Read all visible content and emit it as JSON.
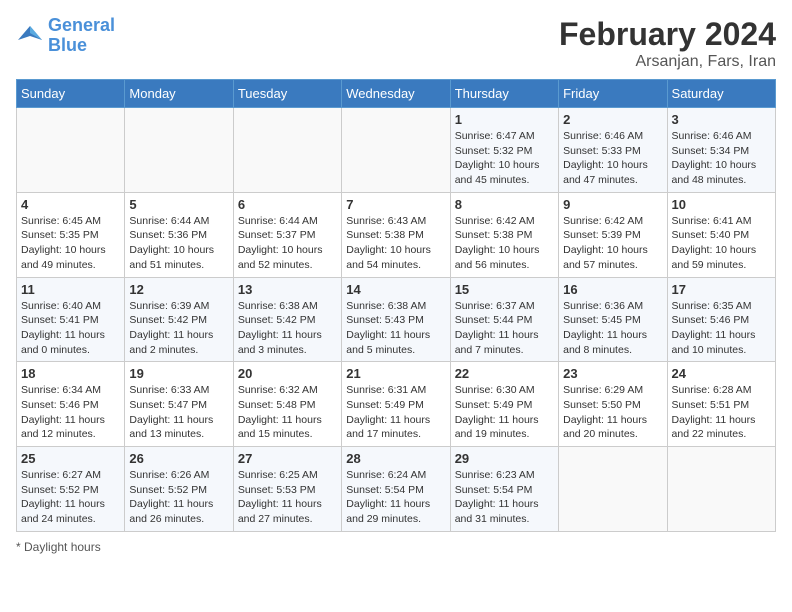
{
  "header": {
    "logo_line1": "General",
    "logo_line2": "Blue",
    "month": "February 2024",
    "location": "Arsanjan, Fars, Iran"
  },
  "weekdays": [
    "Sunday",
    "Monday",
    "Tuesday",
    "Wednesday",
    "Thursday",
    "Friday",
    "Saturday"
  ],
  "weeks": [
    [
      {
        "day": "",
        "sunrise": "",
        "sunset": "",
        "daylight": ""
      },
      {
        "day": "",
        "sunrise": "",
        "sunset": "",
        "daylight": ""
      },
      {
        "day": "",
        "sunrise": "",
        "sunset": "",
        "daylight": ""
      },
      {
        "day": "",
        "sunrise": "",
        "sunset": "",
        "daylight": ""
      },
      {
        "day": "1",
        "sunrise": "Sunrise: 6:47 AM",
        "sunset": "Sunset: 5:32 PM",
        "daylight": "Daylight: 10 hours and 45 minutes."
      },
      {
        "day": "2",
        "sunrise": "Sunrise: 6:46 AM",
        "sunset": "Sunset: 5:33 PM",
        "daylight": "Daylight: 10 hours and 47 minutes."
      },
      {
        "day": "3",
        "sunrise": "Sunrise: 6:46 AM",
        "sunset": "Sunset: 5:34 PM",
        "daylight": "Daylight: 10 hours and 48 minutes."
      }
    ],
    [
      {
        "day": "4",
        "sunrise": "Sunrise: 6:45 AM",
        "sunset": "Sunset: 5:35 PM",
        "daylight": "Daylight: 10 hours and 49 minutes."
      },
      {
        "day": "5",
        "sunrise": "Sunrise: 6:44 AM",
        "sunset": "Sunset: 5:36 PM",
        "daylight": "Daylight: 10 hours and 51 minutes."
      },
      {
        "day": "6",
        "sunrise": "Sunrise: 6:44 AM",
        "sunset": "Sunset: 5:37 PM",
        "daylight": "Daylight: 10 hours and 52 minutes."
      },
      {
        "day": "7",
        "sunrise": "Sunrise: 6:43 AM",
        "sunset": "Sunset: 5:38 PM",
        "daylight": "Daylight: 10 hours and 54 minutes."
      },
      {
        "day": "8",
        "sunrise": "Sunrise: 6:42 AM",
        "sunset": "Sunset: 5:38 PM",
        "daylight": "Daylight: 10 hours and 56 minutes."
      },
      {
        "day": "9",
        "sunrise": "Sunrise: 6:42 AM",
        "sunset": "Sunset: 5:39 PM",
        "daylight": "Daylight: 10 hours and 57 minutes."
      },
      {
        "day": "10",
        "sunrise": "Sunrise: 6:41 AM",
        "sunset": "Sunset: 5:40 PM",
        "daylight": "Daylight: 10 hours and 59 minutes."
      }
    ],
    [
      {
        "day": "11",
        "sunrise": "Sunrise: 6:40 AM",
        "sunset": "Sunset: 5:41 PM",
        "daylight": "Daylight: 11 hours and 0 minutes."
      },
      {
        "day": "12",
        "sunrise": "Sunrise: 6:39 AM",
        "sunset": "Sunset: 5:42 PM",
        "daylight": "Daylight: 11 hours and 2 minutes."
      },
      {
        "day": "13",
        "sunrise": "Sunrise: 6:38 AM",
        "sunset": "Sunset: 5:42 PM",
        "daylight": "Daylight: 11 hours and 3 minutes."
      },
      {
        "day": "14",
        "sunrise": "Sunrise: 6:38 AM",
        "sunset": "Sunset: 5:43 PM",
        "daylight": "Daylight: 11 hours and 5 minutes."
      },
      {
        "day": "15",
        "sunrise": "Sunrise: 6:37 AM",
        "sunset": "Sunset: 5:44 PM",
        "daylight": "Daylight: 11 hours and 7 minutes."
      },
      {
        "day": "16",
        "sunrise": "Sunrise: 6:36 AM",
        "sunset": "Sunset: 5:45 PM",
        "daylight": "Daylight: 11 hours and 8 minutes."
      },
      {
        "day": "17",
        "sunrise": "Sunrise: 6:35 AM",
        "sunset": "Sunset: 5:46 PM",
        "daylight": "Daylight: 11 hours and 10 minutes."
      }
    ],
    [
      {
        "day": "18",
        "sunrise": "Sunrise: 6:34 AM",
        "sunset": "Sunset: 5:46 PM",
        "daylight": "Daylight: 11 hours and 12 minutes."
      },
      {
        "day": "19",
        "sunrise": "Sunrise: 6:33 AM",
        "sunset": "Sunset: 5:47 PM",
        "daylight": "Daylight: 11 hours and 13 minutes."
      },
      {
        "day": "20",
        "sunrise": "Sunrise: 6:32 AM",
        "sunset": "Sunset: 5:48 PM",
        "daylight": "Daylight: 11 hours and 15 minutes."
      },
      {
        "day": "21",
        "sunrise": "Sunrise: 6:31 AM",
        "sunset": "Sunset: 5:49 PM",
        "daylight": "Daylight: 11 hours and 17 minutes."
      },
      {
        "day": "22",
        "sunrise": "Sunrise: 6:30 AM",
        "sunset": "Sunset: 5:49 PM",
        "daylight": "Daylight: 11 hours and 19 minutes."
      },
      {
        "day": "23",
        "sunrise": "Sunrise: 6:29 AM",
        "sunset": "Sunset: 5:50 PM",
        "daylight": "Daylight: 11 hours and 20 minutes."
      },
      {
        "day": "24",
        "sunrise": "Sunrise: 6:28 AM",
        "sunset": "Sunset: 5:51 PM",
        "daylight": "Daylight: 11 hours and 22 minutes."
      }
    ],
    [
      {
        "day": "25",
        "sunrise": "Sunrise: 6:27 AM",
        "sunset": "Sunset: 5:52 PM",
        "daylight": "Daylight: 11 hours and 24 minutes."
      },
      {
        "day": "26",
        "sunrise": "Sunrise: 6:26 AM",
        "sunset": "Sunset: 5:52 PM",
        "daylight": "Daylight: 11 hours and 26 minutes."
      },
      {
        "day": "27",
        "sunrise": "Sunrise: 6:25 AM",
        "sunset": "Sunset: 5:53 PM",
        "daylight": "Daylight: 11 hours and 27 minutes."
      },
      {
        "day": "28",
        "sunrise": "Sunrise: 6:24 AM",
        "sunset": "Sunset: 5:54 PM",
        "daylight": "Daylight: 11 hours and 29 minutes."
      },
      {
        "day": "29",
        "sunrise": "Sunrise: 6:23 AM",
        "sunset": "Sunset: 5:54 PM",
        "daylight": "Daylight: 11 hours and 31 minutes."
      },
      {
        "day": "",
        "sunrise": "",
        "sunset": "",
        "daylight": ""
      },
      {
        "day": "",
        "sunrise": "",
        "sunset": "",
        "daylight": ""
      }
    ]
  ],
  "footer": {
    "daylight_label": "Daylight hours"
  }
}
